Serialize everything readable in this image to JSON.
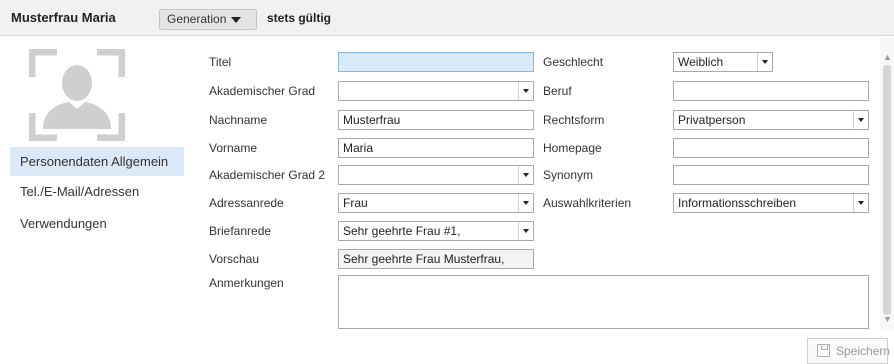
{
  "header": {
    "person_name": "Musterfrau Maria",
    "generation_label": "Generation",
    "validity": "stets gültig"
  },
  "sidebar": {
    "avatar_icon": "person-silhouette-icon",
    "items": [
      {
        "label": "Personendaten Allgemein",
        "active": true
      },
      {
        "label": "Tel./E-Mail/Adressen",
        "active": false
      },
      {
        "label": "Verwendungen",
        "active": false
      }
    ]
  },
  "form": {
    "titel": {
      "label": "Titel",
      "value": ""
    },
    "akad_grad": {
      "label": "Akademischer Grad",
      "value": ""
    },
    "nachname": {
      "label": "Nachname",
      "value": "Musterfrau"
    },
    "vorname": {
      "label": "Vorname",
      "value": "Maria"
    },
    "akad_grad2": {
      "label": "Akademischer Grad 2",
      "value": ""
    },
    "adressanrede": {
      "label": "Adressanrede",
      "value": "Frau"
    },
    "briefanrede": {
      "label": "Briefanrede",
      "value": "Sehr geehrte Frau #1,"
    },
    "vorschau": {
      "label": "Vorschau",
      "value": "Sehr geehrte Frau Musterfrau,"
    },
    "anmerkungen": {
      "label": "Anmerkungen",
      "value": ""
    },
    "geschlecht": {
      "label": "Geschlecht",
      "value": "Weiblich"
    },
    "beruf": {
      "label": "Beruf",
      "value": ""
    },
    "rechtsform": {
      "label": "Rechtsform",
      "value": "Privatperson"
    },
    "homepage": {
      "label": "Homepage",
      "value": ""
    },
    "synonym": {
      "label": "Synonym",
      "value": ""
    },
    "auswahlkriterien": {
      "label": "Auswahlkriterien",
      "value": "Informationsschreiben"
    }
  },
  "actions": {
    "save_label": "Speichern"
  },
  "colors": {
    "focused_field": "#d9ebfb",
    "active_nav": "#dbe8f5",
    "header_bg": "#f1f1f1"
  }
}
